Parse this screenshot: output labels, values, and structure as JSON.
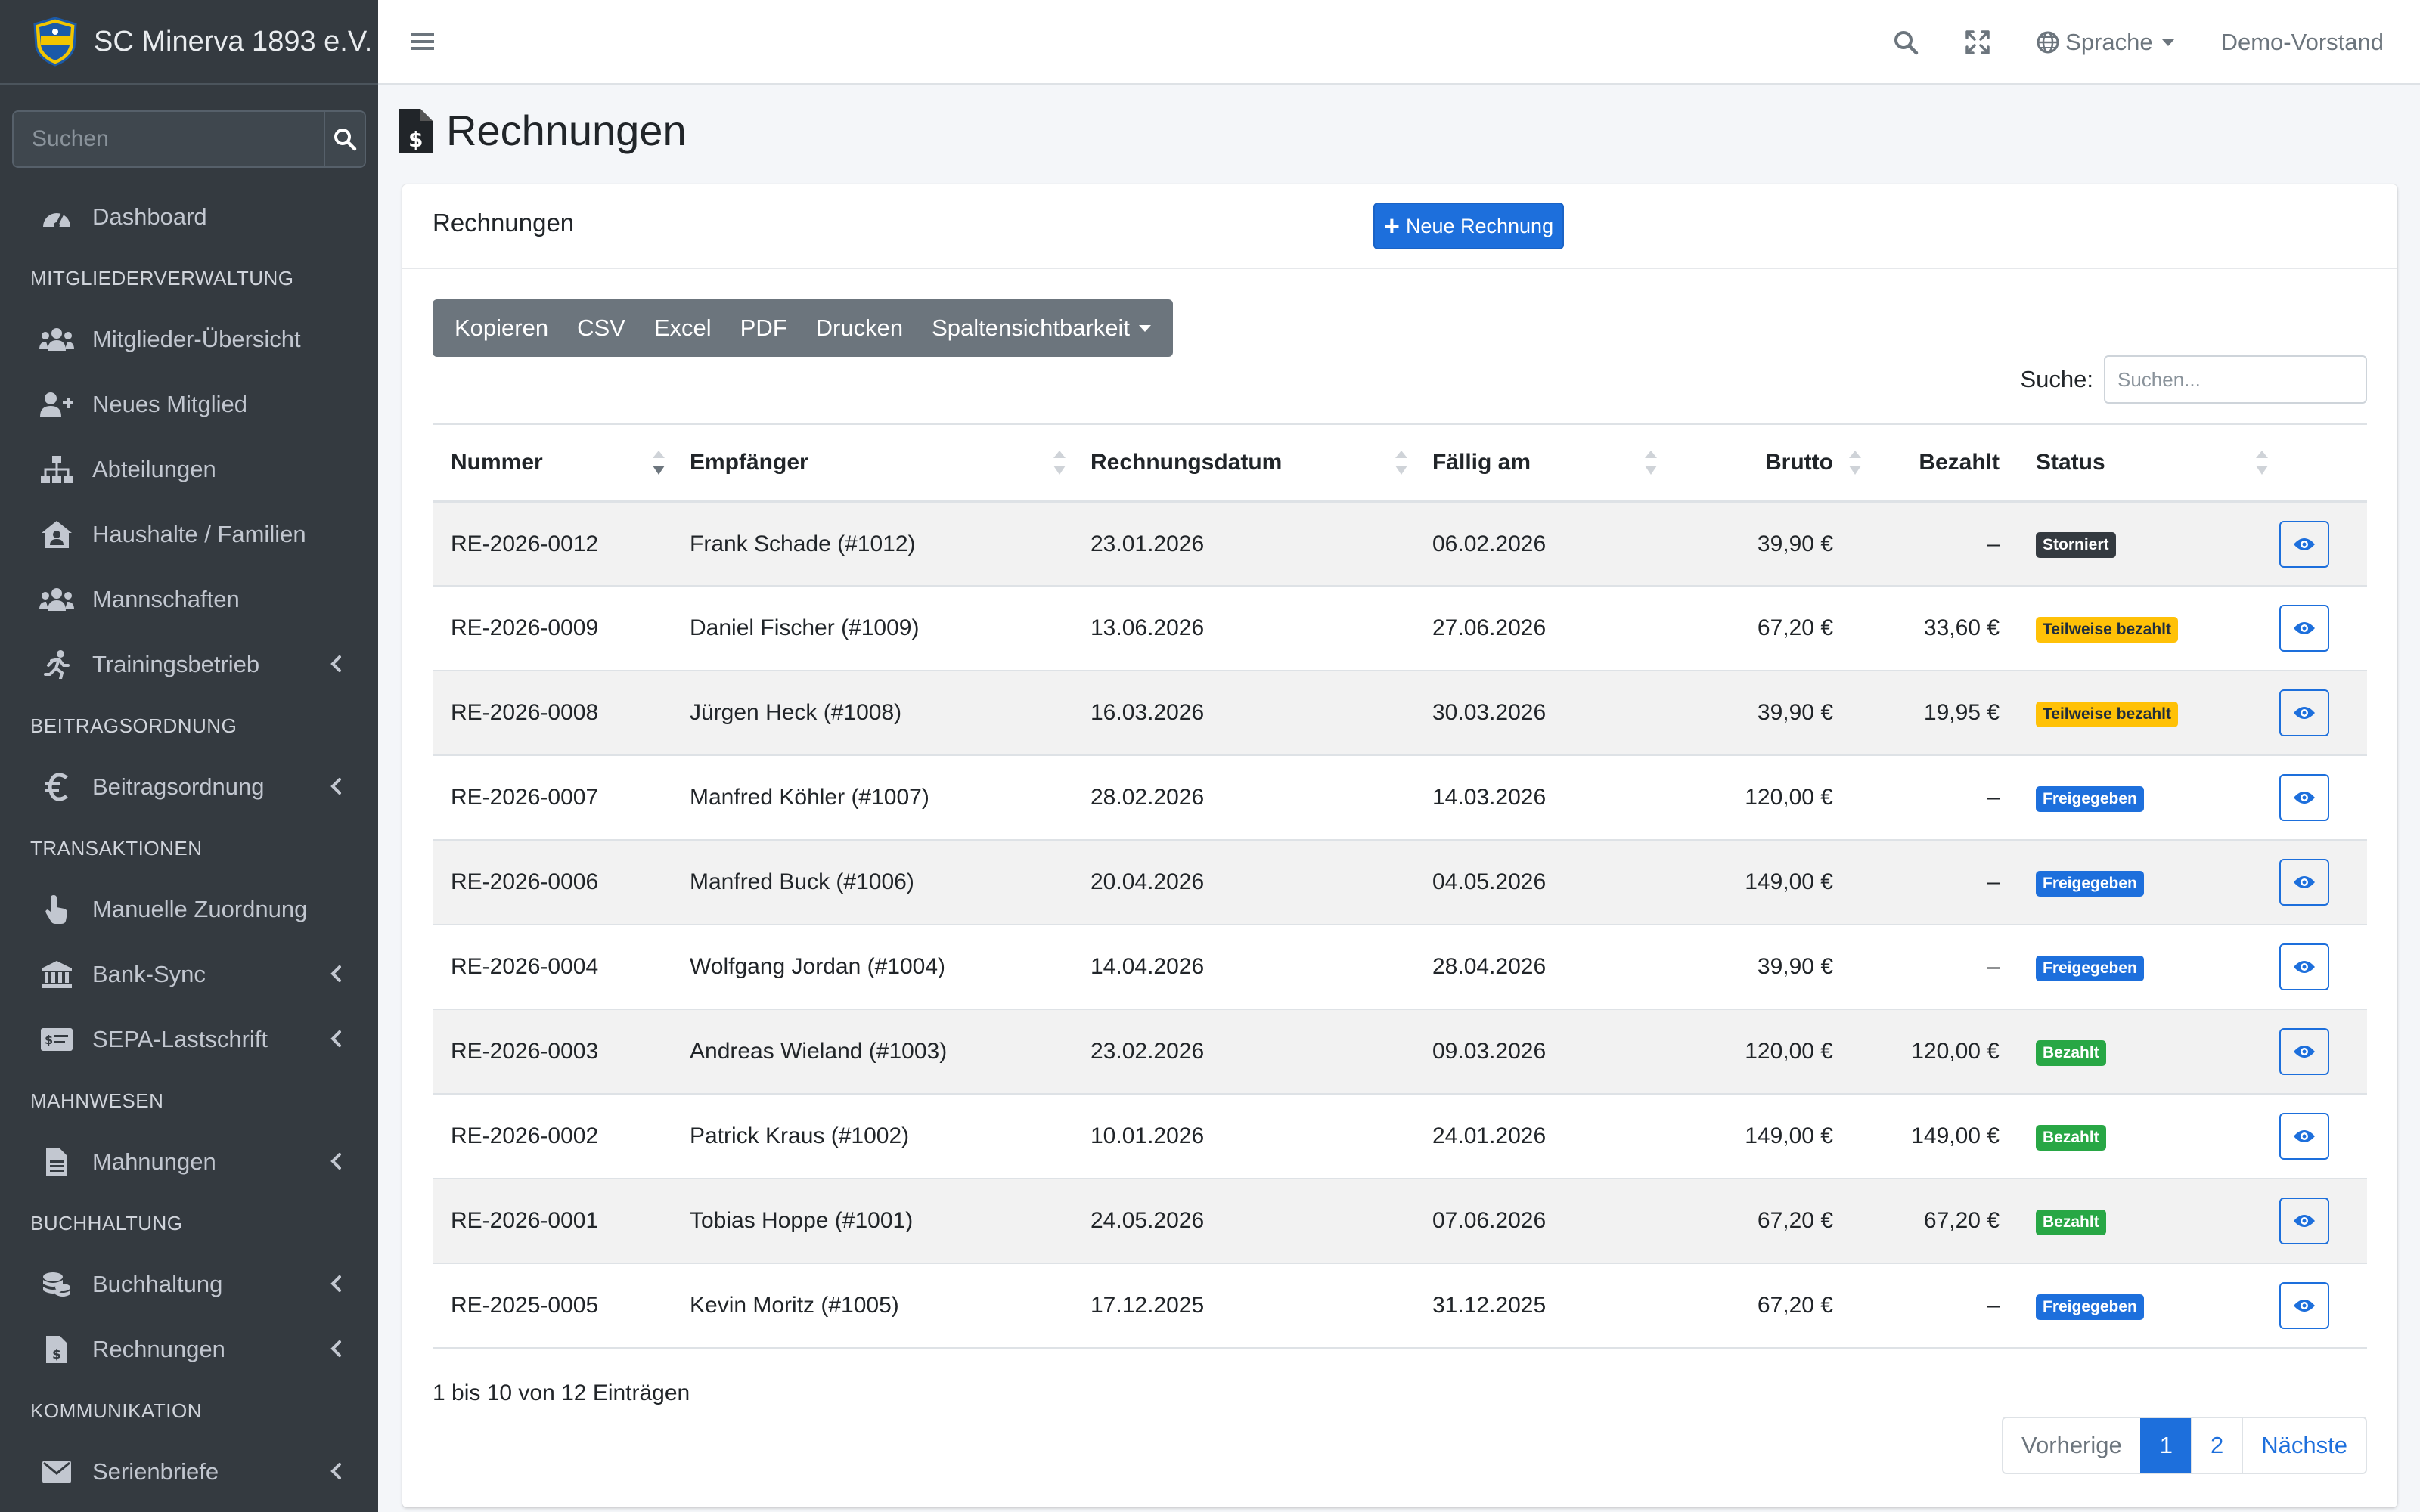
{
  "brand": {
    "name": "SC Minerva 1893 e.V."
  },
  "sidebar": {
    "search_placeholder": "Suchen",
    "items": [
      {
        "type": "item",
        "label": "Dashboard",
        "icon": "dashboard-icon"
      },
      {
        "type": "header",
        "label": "MITGLIEDERVERWALTUNG"
      },
      {
        "type": "item",
        "label": "Mitglieder-Übersicht",
        "icon": "users-icon"
      },
      {
        "type": "item",
        "label": "Neues Mitglied",
        "icon": "user-plus-icon"
      },
      {
        "type": "item",
        "label": "Abteilungen",
        "icon": "sitemap-icon"
      },
      {
        "type": "item",
        "label": "Haushalte / Familien",
        "icon": "house-user-icon"
      },
      {
        "type": "item",
        "label": "Mannschaften",
        "icon": "users-icon"
      },
      {
        "type": "item",
        "label": "Trainingsbetrieb",
        "icon": "running-icon",
        "chevron": true
      },
      {
        "type": "header",
        "label": "BEITRAGSORDNUNG"
      },
      {
        "type": "item",
        "label": "Beitragsordnung",
        "icon": "euro-icon",
        "chevron": true
      },
      {
        "type": "header",
        "label": "TRANSAKTIONEN"
      },
      {
        "type": "item",
        "label": "Manuelle Zuordnung",
        "icon": "hand-pointer-icon"
      },
      {
        "type": "item",
        "label": "Bank-Sync",
        "icon": "bank-icon",
        "chevron": true
      },
      {
        "type": "item",
        "label": "SEPA-Lastschrift",
        "icon": "money-check-icon",
        "chevron": true
      },
      {
        "type": "header",
        "label": "MAHNWESEN"
      },
      {
        "type": "item",
        "label": "Mahnungen",
        "icon": "file-alt-icon",
        "chevron": true
      },
      {
        "type": "header",
        "label": "BUCHHALTUNG"
      },
      {
        "type": "item",
        "label": "Buchhaltung",
        "icon": "coins-icon",
        "chevron": true
      },
      {
        "type": "item",
        "label": "Rechnungen",
        "icon": "file-invoice-dollar-icon",
        "chevron": true
      },
      {
        "type": "header",
        "label": "KOMMUNIKATION"
      },
      {
        "type": "item",
        "label": "Serienbriefe",
        "icon": "envelope-icon",
        "chevron": true
      }
    ]
  },
  "topbar": {
    "language_label": "Sprache",
    "user_label": "Demo-Vorstand"
  },
  "page": {
    "title": "Rechnungen"
  },
  "card": {
    "title": "Rechnungen",
    "new_button": "Neue Rechnung",
    "export_buttons": [
      "Kopieren",
      "CSV",
      "Excel",
      "PDF",
      "Drucken",
      "Spaltensichtbarkeit"
    ],
    "search_label": "Suche:",
    "search_placeholder": "Suchen...",
    "columns": [
      "Nummer",
      "Empfänger",
      "Rechnungsdatum",
      "Fällig am",
      "Brutto",
      "Bezahlt",
      "Status"
    ],
    "rows": [
      {
        "nummer": "RE-2026-0012",
        "empfaenger": "Frank Schade (#1012)",
        "datum": "23.01.2026",
        "faellig": "06.02.2026",
        "brutto": "39,90 €",
        "bezahlt": "–",
        "status": "Storniert",
        "status_class": "b-dark"
      },
      {
        "nummer": "RE-2026-0009",
        "empfaenger": "Daniel Fischer (#1009)",
        "datum": "13.06.2026",
        "faellig": "27.06.2026",
        "brutto": "67,20 €",
        "bezahlt": "33,60 €",
        "status": "Teilweise bezahlt",
        "status_class": "b-warn"
      },
      {
        "nummer": "RE-2026-0008",
        "empfaenger": "Jürgen Heck (#1008)",
        "datum": "16.03.2026",
        "faellig": "30.03.2026",
        "brutto": "39,90 €",
        "bezahlt": "19,95 €",
        "status": "Teilweise bezahlt",
        "status_class": "b-warn"
      },
      {
        "nummer": "RE-2026-0007",
        "empfaenger": "Manfred Köhler (#1007)",
        "datum": "28.02.2026",
        "faellig": "14.03.2026",
        "brutto": "120,00 €",
        "bezahlt": "–",
        "status": "Freigegeben",
        "status_class": "b-blue"
      },
      {
        "nummer": "RE-2026-0006",
        "empfaenger": "Manfred Buck (#1006)",
        "datum": "20.04.2026",
        "faellig": "04.05.2026",
        "brutto": "149,00 €",
        "bezahlt": "–",
        "status": "Freigegeben",
        "status_class": "b-blue"
      },
      {
        "nummer": "RE-2026-0004",
        "empfaenger": "Wolfgang Jordan (#1004)",
        "datum": "14.04.2026",
        "faellig": "28.04.2026",
        "brutto": "39,90 €",
        "bezahlt": "–",
        "status": "Freigegeben",
        "status_class": "b-blue"
      },
      {
        "nummer": "RE-2026-0003",
        "empfaenger": "Andreas Wieland (#1003)",
        "datum": "23.02.2026",
        "faellig": "09.03.2026",
        "brutto": "120,00 €",
        "bezahlt": "120,00 €",
        "status": "Bezahlt",
        "status_class": "b-green"
      },
      {
        "nummer": "RE-2026-0002",
        "empfaenger": "Patrick Kraus (#1002)",
        "datum": "10.01.2026",
        "faellig": "24.01.2026",
        "brutto": "149,00 €",
        "bezahlt": "149,00 €",
        "status": "Bezahlt",
        "status_class": "b-green"
      },
      {
        "nummer": "RE-2026-0001",
        "empfaenger": "Tobias Hoppe (#1001)",
        "datum": "24.05.2026",
        "faellig": "07.06.2026",
        "brutto": "67,20 €",
        "bezahlt": "67,20 €",
        "status": "Bezahlt",
        "status_class": "b-green"
      },
      {
        "nummer": "RE-2025-0005",
        "empfaenger": "Kevin Moritz (#1005)",
        "datum": "17.12.2025",
        "faellig": "31.12.2025",
        "brutto": "67,20 €",
        "bezahlt": "–",
        "status": "Freigegeben",
        "status_class": "b-blue"
      }
    ],
    "info": "1 bis 10 von 12 Einträgen",
    "pagination": {
      "prev": "Vorherige",
      "pages": [
        "1",
        "2"
      ],
      "active": "1",
      "next": "Nächste"
    }
  },
  "colors": {
    "sidebar_bg": "#343a40",
    "primary": "#1d6fdc",
    "success": "#28a745",
    "warning": "#ffc107",
    "dark": "#343a40"
  }
}
